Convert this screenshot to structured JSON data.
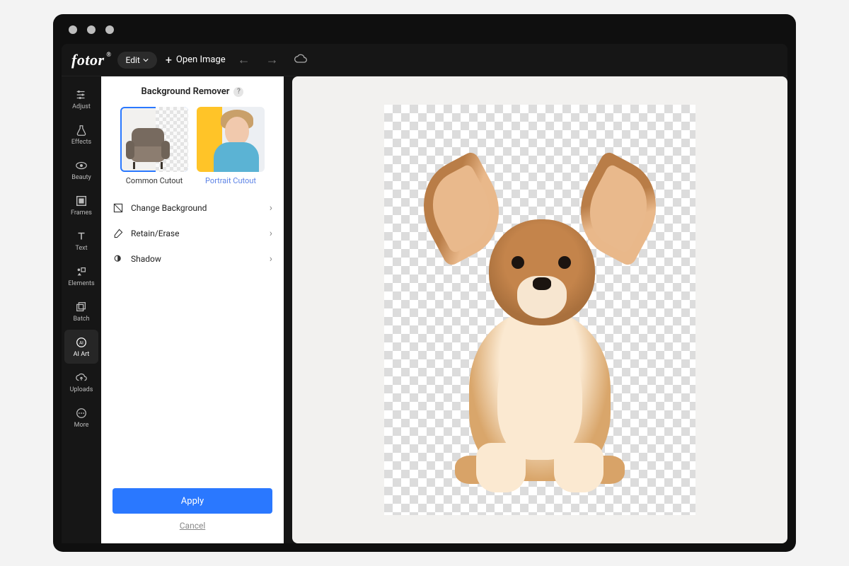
{
  "brand": "fotor",
  "topbar": {
    "edit_label": "Edit",
    "open_image": "Open Image"
  },
  "sidebar": {
    "items": [
      {
        "label": "Adjust",
        "icon": "sliders"
      },
      {
        "label": "Effects",
        "icon": "flask"
      },
      {
        "label": "Beauty",
        "icon": "eye"
      },
      {
        "label": "Frames",
        "icon": "frame"
      },
      {
        "label": "Text",
        "icon": "text"
      },
      {
        "label": "Elements",
        "icon": "elements"
      },
      {
        "label": "Batch",
        "icon": "batch"
      },
      {
        "label": "AI Art",
        "icon": "ai"
      },
      {
        "label": "Uploads",
        "icon": "cloud-up"
      },
      {
        "label": "More",
        "icon": "more"
      }
    ],
    "active_index": 7
  },
  "panel": {
    "title": "Background Remover",
    "cutouts": [
      {
        "label": "Common Cutout",
        "active": true
      },
      {
        "label": "Portrait Cutout",
        "active": false
      }
    ],
    "options": [
      {
        "label": "Change Background",
        "icon": "swap"
      },
      {
        "label": "Retain/Erase",
        "icon": "eraser"
      },
      {
        "label": "Shadow",
        "icon": "shadow"
      }
    ],
    "apply": "Apply",
    "cancel": "Cancel"
  }
}
